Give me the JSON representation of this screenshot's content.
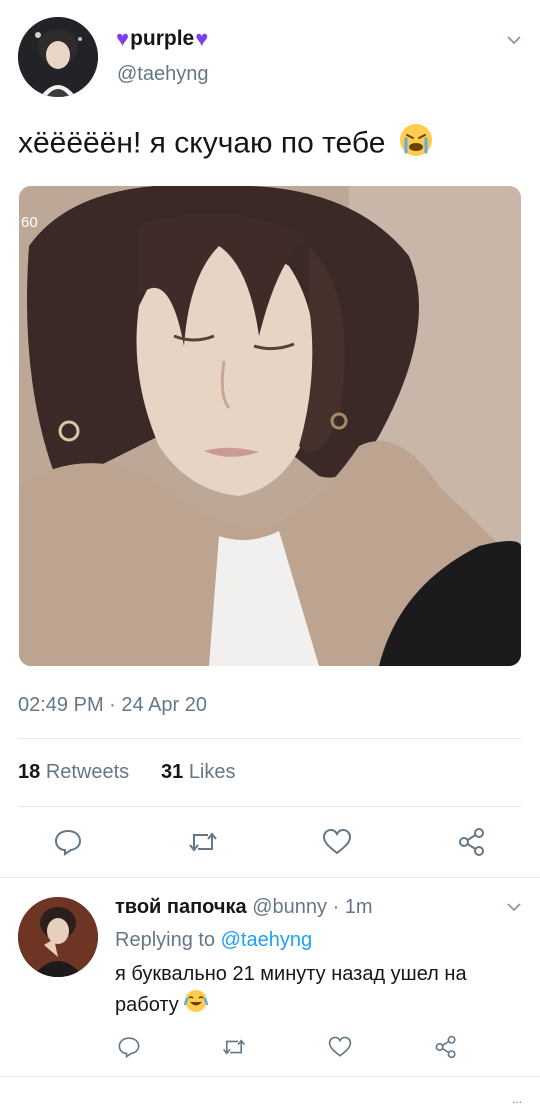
{
  "tweet": {
    "display_name_decor_left": "💜",
    "display_name": "purple",
    "display_name_decor_right": "💜",
    "handle": "@taehyng",
    "text": "хёёёёён! я скучаю по тебе",
    "emoji_icon": "crying-face-emoji",
    "image_counter": "60",
    "timestamp": "02:49 PM · 24 Apr 20",
    "retweets_count": "18",
    "retweets_label": "Retweets",
    "likes_count": "31",
    "likes_label": "Likes"
  },
  "reply": {
    "display_name": "твой папочка",
    "handle": "@bunny",
    "separator": "·",
    "time": "1m",
    "replying_to_label": "Replying to",
    "replying_to_handle": "@taehyng",
    "text": "я буквально 21 минуту назад ушел на работу",
    "emoji_icon": "laughing-tears-emoji"
  },
  "footer": {
    "overflow": "..."
  },
  "colors": {
    "text": "#14171a",
    "muted": "#657786",
    "link": "#1da1f2",
    "divider": "#e1e8ed",
    "heart_purple": "#7e3ff2"
  }
}
